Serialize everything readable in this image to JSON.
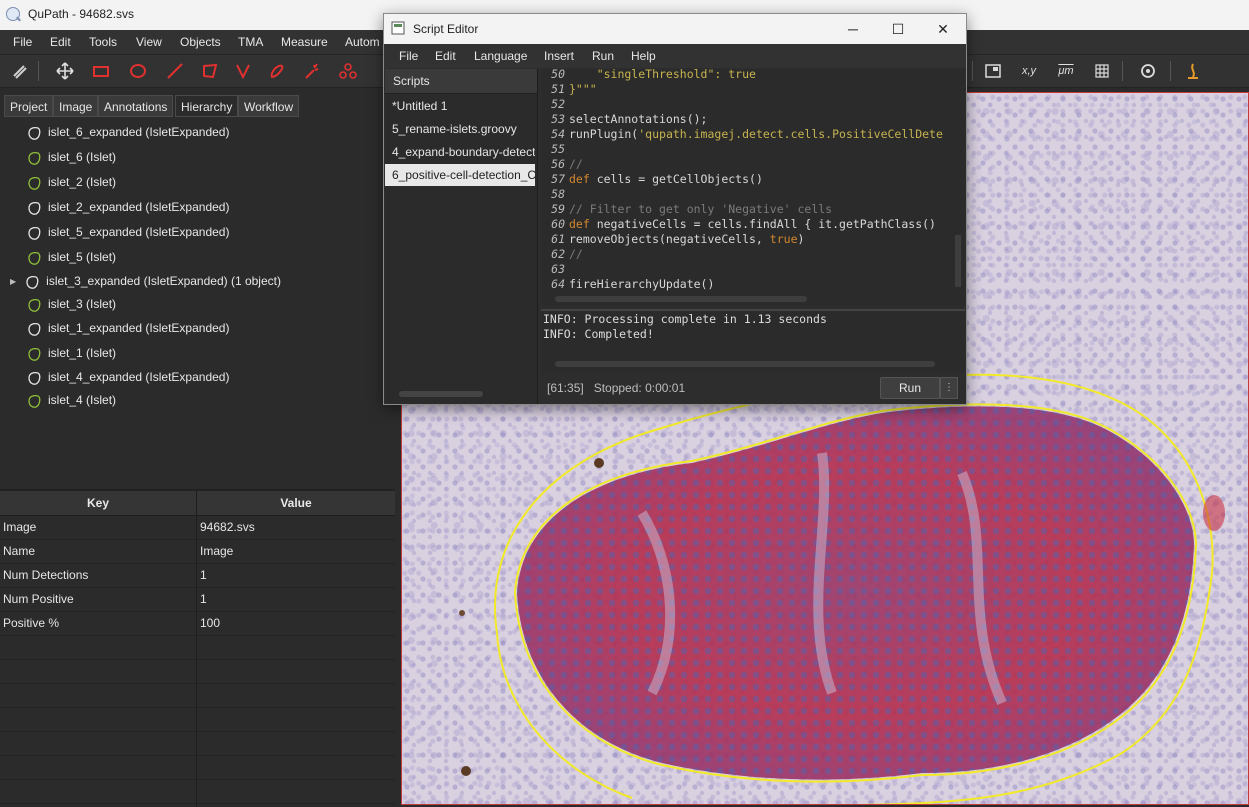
{
  "main": {
    "title": "QuPath - 94682.svs",
    "menu": [
      "File",
      "Edit",
      "Tools",
      "View",
      "Objects",
      "TMA",
      "Measure",
      "Autom"
    ],
    "tabs": [
      "Project",
      "Image",
      "Annotations",
      "Hierarchy",
      "Workflow"
    ],
    "hierarchy": [
      {
        "label": "islet_6_expanded (IsletExpanded)",
        "type": "expanded"
      },
      {
        "label": "islet_6 (Islet)",
        "type": "islet"
      },
      {
        "label": "islet_2 (Islet)",
        "type": "islet"
      },
      {
        "label": "islet_2_expanded (IsletExpanded)",
        "type": "expanded"
      },
      {
        "label": "islet_5_expanded (IsletExpanded)",
        "type": "expanded"
      },
      {
        "label": "islet_5 (Islet)",
        "type": "islet"
      },
      {
        "label": "islet_3_expanded (IsletExpanded) (1 object)",
        "type": "expanded",
        "expandable": true
      },
      {
        "label": "islet_3 (Islet)",
        "type": "islet"
      },
      {
        "label": "islet_1_expanded (IsletExpanded)",
        "type": "expanded"
      },
      {
        "label": "islet_1 (Islet)",
        "type": "islet"
      },
      {
        "label": "islet_4_expanded (IsletExpanded)",
        "type": "expanded"
      },
      {
        "label": "islet_4 (Islet)",
        "type": "islet"
      }
    ],
    "table": {
      "key_header": "Key",
      "value_header": "Value",
      "rows": [
        {
          "key": "Image",
          "value": "94682.svs"
        },
        {
          "key": "Name",
          "value": "Image"
        },
        {
          "key": "Num Detections",
          "value": "1"
        },
        {
          "key": "Num Positive",
          "value": "1"
        },
        {
          "key": "Positive %",
          "value": "100"
        }
      ]
    },
    "toolbar_right": {
      "xy_label": "x,y",
      "um_label": "μm"
    },
    "colors": {
      "islet": "#8fbf3a",
      "expanded": "#e6e6e6",
      "annotation_yellow": "#f2ea28",
      "detection_red": "#c8283a"
    }
  },
  "script_editor": {
    "title": "Script Editor",
    "menu": [
      "File",
      "Edit",
      "Language",
      "Insert",
      "Run",
      "Help"
    ],
    "scripts_header": "Scripts",
    "scripts": [
      "*Untitled 1",
      "5_rename-islets.groovy",
      "4_expand-boundary-detect",
      "6_positive-cell-detection_C"
    ],
    "selected_index": 3,
    "code_lines": [
      {
        "n": "50",
        "parts": [
          {
            "t": "    \"singleThreshold\": true",
            "c": "str"
          }
        ]
      },
      {
        "n": "51",
        "parts": [
          {
            "t": "}\"\"\"",
            "c": "str"
          }
        ]
      },
      {
        "n": "52",
        "parts": []
      },
      {
        "n": "53",
        "parts": [
          {
            "t": "selectAnnotations();",
            "c": "tx"
          }
        ]
      },
      {
        "n": "54",
        "parts": [
          {
            "t": "runPlugin(",
            "c": "tx"
          },
          {
            "t": "'qupath.imagej.detect.cells.PositiveCellDete",
            "c": "str"
          }
        ]
      },
      {
        "n": "55",
        "parts": []
      },
      {
        "n": "56",
        "parts": [
          {
            "t": "//",
            "c": "cm"
          }
        ]
      },
      {
        "n": "57",
        "parts": [
          {
            "t": "def",
            "c": "kw"
          },
          {
            "t": " cells = getCellObjects()",
            "c": "tx"
          }
        ]
      },
      {
        "n": "58",
        "parts": []
      },
      {
        "n": "59",
        "parts": [
          {
            "t": "// Filter to get only 'Negative' cells",
            "c": "cm"
          }
        ]
      },
      {
        "n": "60",
        "parts": [
          {
            "t": "def",
            "c": "kw"
          },
          {
            "t": " negativeCells = cells.findAll { it.getPathClass()",
            "c": "tx"
          }
        ]
      },
      {
        "n": "61",
        "parts": [
          {
            "t": "removeObjects(negativeCells, ",
            "c": "tx"
          },
          {
            "t": "true",
            "c": "bool"
          },
          {
            "t": ")",
            "c": "tx"
          }
        ]
      },
      {
        "n": "62",
        "parts": [
          {
            "t": "//",
            "c": "cm"
          }
        ]
      },
      {
        "n": "63",
        "parts": []
      },
      {
        "n": "64",
        "parts": [
          {
            "t": "fireHierarchyUpdate()",
            "c": "tx"
          }
        ]
      }
    ],
    "console": [
      "INFO: Processing complete in 1.13 seconds",
      "INFO: Completed!"
    ],
    "status": "[61:35]   Stopped: 0:00:01",
    "run_label": "Run",
    "run_more": "⋮"
  }
}
